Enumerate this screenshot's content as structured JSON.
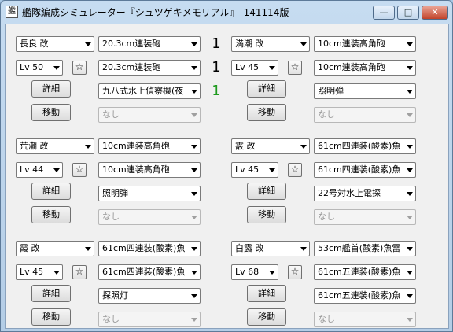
{
  "window": {
    "title": "艦隊編成シミュレーター『シュツゲキメモリアル』　141114版",
    "icon_glyph": "艦",
    "buttons": {
      "minimize": "—",
      "maximize": "□",
      "close": "✕"
    }
  },
  "labels": {
    "detail": "詳細",
    "move": "移動",
    "star": "☆"
  },
  "accent_colors": {
    "count_default": "#000000",
    "count_recon": "#1e9a1e"
  },
  "ships": [
    {
      "name": "長良 改",
      "level": "Lv 50",
      "slots": [
        {
          "item": "20.3cm連装砲",
          "count": "1",
          "enabled": true
        },
        {
          "item": "20.3cm連装砲",
          "count": "1",
          "enabled": true
        },
        {
          "item": "九八式水上偵察機(夜",
          "count": "1",
          "enabled": true,
          "recon": true
        },
        {
          "item": "なし",
          "count": "",
          "enabled": false
        }
      ]
    },
    {
      "name": "満潮 改",
      "level": "Lv 45",
      "slots": [
        {
          "item": "10cm連装高角砲",
          "count": "",
          "enabled": true
        },
        {
          "item": "10cm連装高角砲",
          "count": "",
          "enabled": true
        },
        {
          "item": "照明弾",
          "count": "",
          "enabled": true
        },
        {
          "item": "なし",
          "count": "",
          "enabled": false
        }
      ]
    },
    {
      "name": "荒潮 改",
      "level": "Lv 44",
      "slots": [
        {
          "item": "10cm連装高角砲",
          "count": "",
          "enabled": true
        },
        {
          "item": "10cm連装高角砲",
          "count": "",
          "enabled": true
        },
        {
          "item": "照明弾",
          "count": "",
          "enabled": true
        },
        {
          "item": "なし",
          "count": "",
          "enabled": false
        }
      ]
    },
    {
      "name": "霰 改",
      "level": "Lv 45",
      "slots": [
        {
          "item": "61cm四連装(酸素)魚",
          "count": "",
          "enabled": true
        },
        {
          "item": "61cm四連装(酸素)魚",
          "count": "",
          "enabled": true
        },
        {
          "item": "22号対水上電探",
          "count": "",
          "enabled": true
        },
        {
          "item": "なし",
          "count": "",
          "enabled": false
        }
      ]
    },
    {
      "name": "霞 改",
      "level": "Lv 45",
      "slots": [
        {
          "item": "61cm四連装(酸素)魚",
          "count": "",
          "enabled": true
        },
        {
          "item": "61cm四連装(酸素)魚",
          "count": "",
          "enabled": true
        },
        {
          "item": "探照灯",
          "count": "",
          "enabled": true
        },
        {
          "item": "なし",
          "count": "",
          "enabled": false
        }
      ]
    },
    {
      "name": "白露 改",
      "level": "Lv 68",
      "slots": [
        {
          "item": "53cm艦首(酸素)魚雷",
          "count": "",
          "enabled": true
        },
        {
          "item": "61cm五連装(酸素)魚",
          "count": "",
          "enabled": true
        },
        {
          "item": "61cm五連装(酸素)魚",
          "count": "",
          "enabled": true
        },
        {
          "item": "なし",
          "count": "",
          "enabled": false
        }
      ]
    }
  ]
}
